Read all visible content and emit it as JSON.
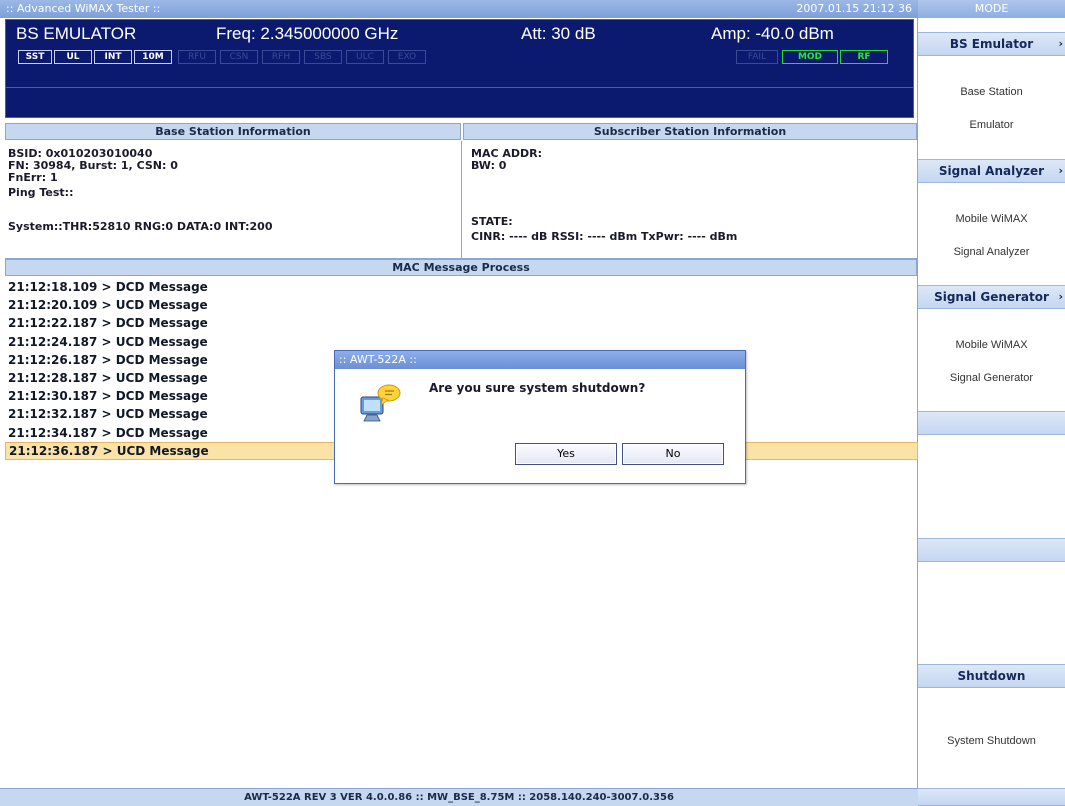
{
  "window": {
    "title": ":: Advanced WiMAX Tester ::",
    "datetime": "2007.01.15 21:12 36"
  },
  "status": {
    "mode": "BS EMULATOR",
    "freq": "Freq: 2.345000000 GHz",
    "att": "Att: 30 dB",
    "amp": "Amp: -40.0 dBm",
    "indicators_left": [
      "SST",
      "UL",
      "INT",
      "10M"
    ],
    "indicators_dim": [
      "RFU",
      "CSN",
      "RFH",
      "SBS",
      "ULC",
      "EXO"
    ],
    "indicator_fail": "FAIL",
    "indicator_mod": "MOD",
    "indicator_rf": "RF"
  },
  "bs_info": {
    "header": "Base Station Information",
    "bsid": "BSID: 0x010203010040",
    "fn": "FN:   30984, Burst: 1, CSN: 0",
    "fnerr": "FnErr: 1",
    "ping": "Ping Test::",
    "system": "System::THR:52810  RNG:0  DATA:0  INT:200"
  },
  "ss_info": {
    "header": "Subscriber Station Information",
    "mac": "MAC ADDR:",
    "bw": "BW: 0",
    "state": "STATE:",
    "metrics": "CINR: ---- dB    RSSI: ---- dBm    TxPwr: ---- dBm"
  },
  "mac_process": {
    "header": "MAC Message Process",
    "messages": [
      "21:12:18.109 > DCD Message",
      "21:12:20.109 > UCD Message",
      "21:12:22.187 > DCD Message",
      "21:12:24.187 > UCD Message",
      "21:12:26.187 > DCD Message",
      "21:12:28.187 > UCD Message",
      "21:12:30.187 > DCD Message",
      "21:12:32.187 > UCD Message",
      "21:12:34.187 > DCD Message",
      "21:12:36.187 > UCD Message"
    ],
    "selected_index": 9
  },
  "footer": "AWT-522A REV 3 VER 4.0.0.86 :: MW_BSE_8.75M :: 2058.140.240-3007.0.356",
  "sidebar": {
    "header": "MODE",
    "categories": [
      {
        "label": "BS Emulator",
        "lines": [
          "Base Station",
          "Emulator"
        ]
      },
      {
        "label": "Signal Analyzer",
        "lines": [
          "Mobile WiMAX",
          "Signal Analyzer"
        ]
      },
      {
        "label": "Signal Generator",
        "lines": [
          "Mobile WiMAX",
          "Signal Generator"
        ]
      },
      {
        "label": "Shutdown",
        "lines": [
          "System Shutdown"
        ]
      }
    ],
    "chevron": "›"
  },
  "dialog": {
    "title": ":: AWT-522A ::",
    "message": "Are you sure system shutdown?",
    "yes_label": "Yes",
    "no_label": "No"
  },
  "colors": {
    "status_bg": "#0b1a6e",
    "header_bg": "#c6d8f0",
    "selected_row": "#fbe3a8",
    "green_indicator": "#22ee22"
  }
}
